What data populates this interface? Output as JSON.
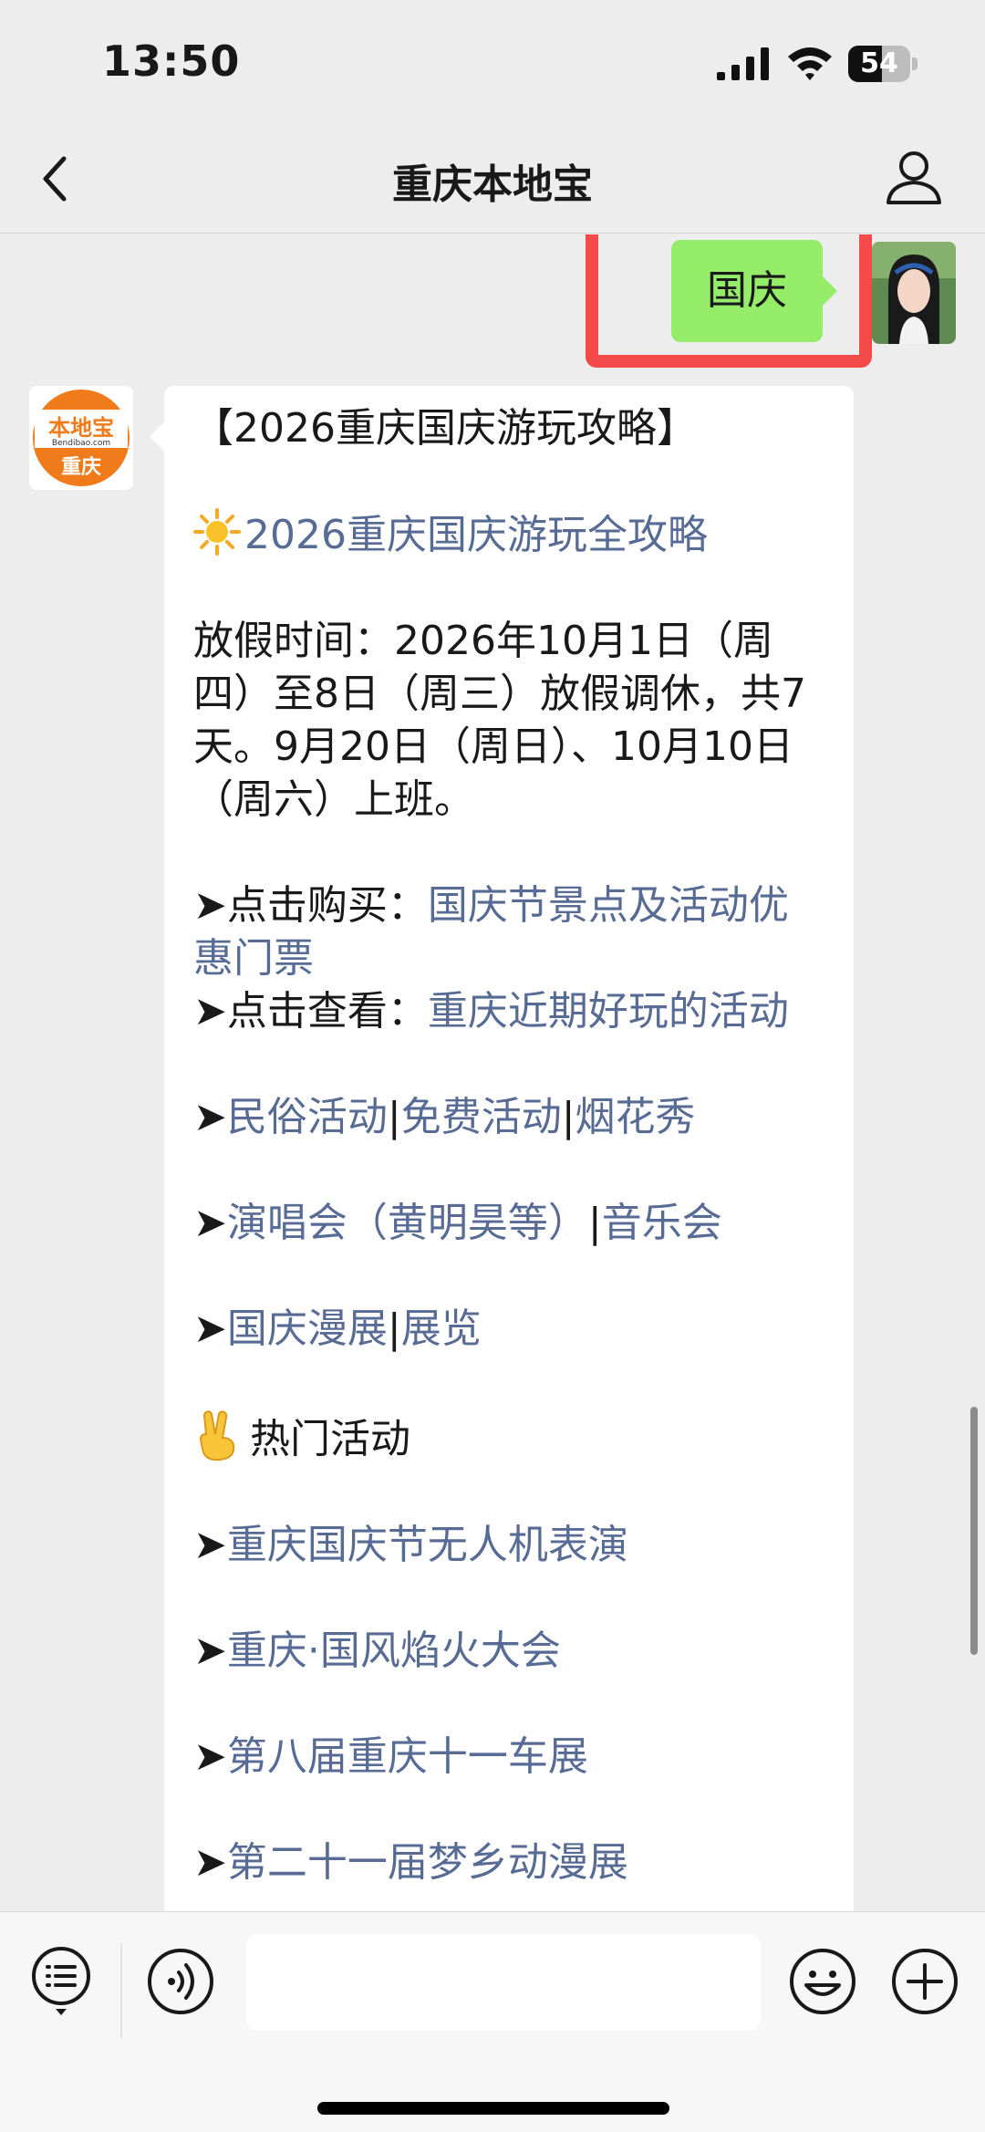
{
  "status_bar": {
    "time": "13:50",
    "battery": "54",
    "battery_level": 0.54,
    "icons": [
      "signal-icon",
      "wifi-icon",
      "battery-icon"
    ]
  },
  "nav": {
    "title": "重庆本地宝",
    "back_icon": "chevron-left-icon",
    "profile_icon": "person-icon"
  },
  "user_message": {
    "text": "国庆"
  },
  "bot": {
    "avatar_text_top": "本地宝",
    "avatar_text_url": "Bendibao.com",
    "avatar_text_city": "重庆",
    "accent_color": "#f07b1a"
  },
  "bot_message": {
    "title": "【2026重庆国庆游玩攻略】",
    "guide_link": "2026重庆国庆游玩全攻略",
    "holiday_text": "放假时间：2026年10月1日（周四）至8日（周三）放假调休，共7天。9月20日（周日）、10月10日（周六）上班。",
    "arrow": "➤",
    "buy_prefix": "点击购买：",
    "buy_link": "国庆节景点及活动优惠门票",
    "view_prefix": "点击查看：",
    "view_link": "重庆近期好玩的活动",
    "sep": "|",
    "links_row1": [
      "民俗活动",
      "免费活动",
      "烟花秀"
    ],
    "links_row2": [
      "演唱会（黄明昊等）",
      "音乐会"
    ],
    "links_row3": [
      "国庆漫展",
      "展览"
    ],
    "hot_title": "热门活动",
    "hot_items": [
      "重庆国庆节无人机表演",
      "重庆·国风焰火大会",
      "第八届重庆十一车展",
      "第二十一届梦乡动漫展"
    ]
  },
  "colors": {
    "link": "#576b95",
    "user_bubble": "#95ec69",
    "highlight": "#f44a4a",
    "background": "#ededed"
  },
  "input_bar": {
    "placeholder": "",
    "icons": [
      "menu-list-icon",
      "voice-icon",
      "emoji-icon",
      "plus-icon"
    ]
  }
}
